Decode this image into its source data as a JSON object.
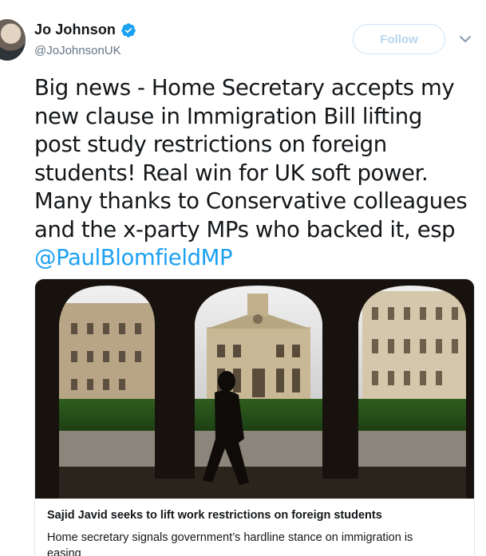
{
  "author": {
    "display_name": "Jo Johnson",
    "handle": "@JoJohnsonUK",
    "verified": true
  },
  "actions": {
    "follow_label": "Follow"
  },
  "tweet": {
    "text": "Big news - Home Secretary accepts my\nnew clause in Immigration Bill lifting\npost study restrictions on foreign\nstudents! Real win for UK soft power.\nMany thanks to Conservative colleagues\nand the x-party MPs who backed it, esp",
    "mention": "@PaulBlomfieldMP"
  },
  "card": {
    "title": "Sajid Javid seeks to lift work restrictions on foreign students",
    "description": "Home secretary signals government’s hardline stance on immigration is easing"
  },
  "colors": {
    "link": "#1da1f2",
    "verified": "#1da1f2",
    "follow_border": "#cfe3f3",
    "follow_text": "#b5d6f0",
    "secondary_text": "#657786"
  },
  "icons": {
    "verified": "verified-badge-icon",
    "menu": "chevron-down-icon"
  }
}
